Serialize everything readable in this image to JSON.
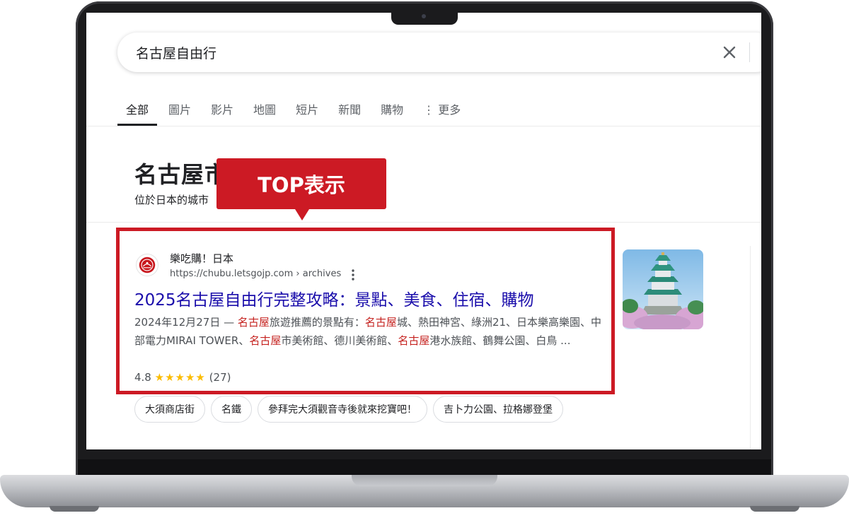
{
  "search": {
    "query": "名古屋自由行"
  },
  "tabs": [
    {
      "label": "全部"
    },
    {
      "label": "圖片"
    },
    {
      "label": "影片"
    },
    {
      "label": "地圖"
    },
    {
      "label": "短片"
    },
    {
      "label": "新聞"
    },
    {
      "label": "購物"
    },
    {
      "label": "⋮ 更多"
    }
  ],
  "knowledge_panel": {
    "title": "名古屋市",
    "subtitle": "位於日本的城市"
  },
  "callout": {
    "label": "TOP表示"
  },
  "result": {
    "site_name": "樂吃購！日本",
    "url": "https://chubu.letsgojp.com › archives",
    "title": "2025名古屋自由行完整攻略：景點、美食、住宿、購物",
    "snippet": {
      "date": "2024年12月27日 — ",
      "p1": "名古屋",
      "t1": "旅遊推薦的景點有：",
      "p2": "名古屋",
      "t2": "城、熱田神宮、綠洲21、日本樂高樂園、中部電力MIRAI TOWER、",
      "p3": "名古屋",
      "t3": "市美術館、德川美術館、",
      "p4": "名古屋",
      "t4": "港水族館、鶴舞公園、白鳥 ..."
    },
    "rating_value": "4.8",
    "stars": "★★★★★",
    "review_count": "(27)"
  },
  "chips": [
    {
      "label": "大須商店街"
    },
    {
      "label": "名鐵"
    },
    {
      "label": "參拜完大須觀音寺後就來挖寶吧！"
    },
    {
      "label": "吉卜力公園、拉格娜登堡"
    }
  ],
  "colors": {
    "accent_red": "#cc1a24",
    "link_blue": "#1a0dab",
    "highlight_red": "#c5221f",
    "star_yellow": "#fbbc04"
  }
}
